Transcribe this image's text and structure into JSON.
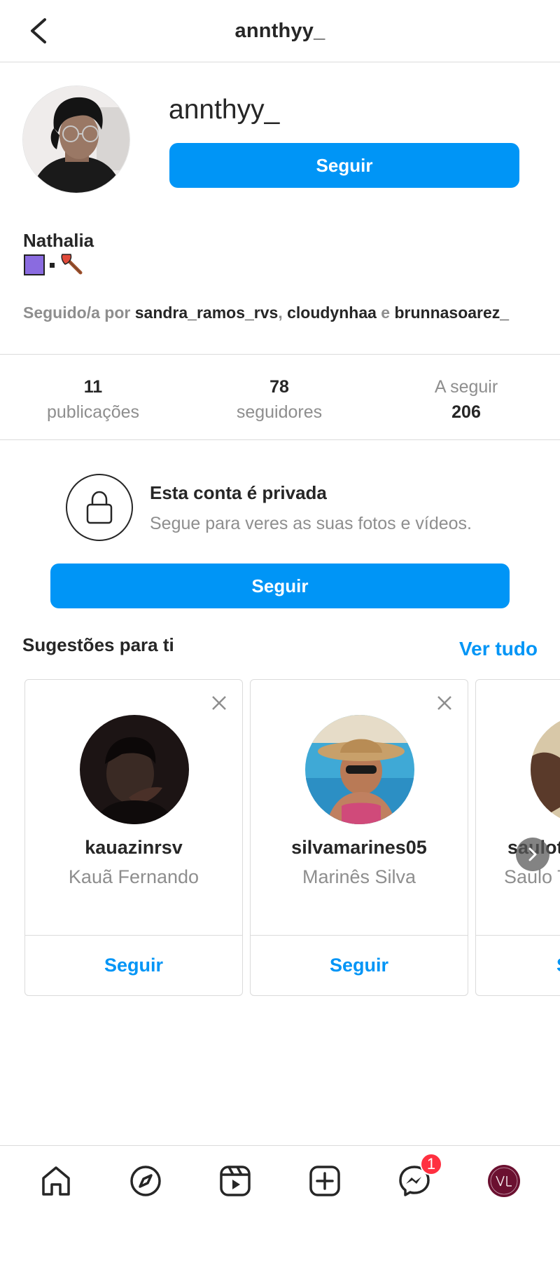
{
  "header": {
    "title": "annthyy_"
  },
  "profile": {
    "username": "annthyy_",
    "follow_label": "Seguir",
    "full_name": "Nathalia",
    "followed_by_prefix": "Seguido/a por",
    "followed_by_users": [
      "sandra_ramos_rvs",
      "cloudynhaa",
      "brunnasoarez_"
    ],
    "followed_by_sep1": ",",
    "followed_by_sep2": "e"
  },
  "stats": {
    "posts": {
      "value": "11",
      "label": "publicações"
    },
    "followers": {
      "value": "78",
      "label": "seguidores"
    },
    "following": {
      "value": "206",
      "label": "A seguir"
    }
  },
  "private_notice": {
    "title": "Esta conta é privada",
    "subtitle": "Segue para veres as suas fotos e vídeos.",
    "follow_label": "Seguir"
  },
  "suggestions": {
    "title": "Sugestões para ti",
    "see_all": "Ver tudo",
    "cards": [
      {
        "username": "kauazinrsv",
        "name": "Kauã Fernando",
        "follow_label": "Seguir"
      },
      {
        "username": "silvamarines05",
        "name": "Marinês Silva",
        "follow_label": "Seguir"
      },
      {
        "username": "saulot",
        "name": "Saulo T",
        "follow_label": "S"
      }
    ]
  },
  "bottom_nav": {
    "messages_badge": "1",
    "items": [
      "home-icon",
      "explore-icon",
      "reels-icon",
      "new-post-icon",
      "messenger-icon",
      "profile-avatar"
    ]
  },
  "colors": {
    "accent": "#0095f6",
    "badge": "#ff3040",
    "text": "#262626",
    "muted": "#8e8e8e",
    "border": "#dbdbdb"
  }
}
